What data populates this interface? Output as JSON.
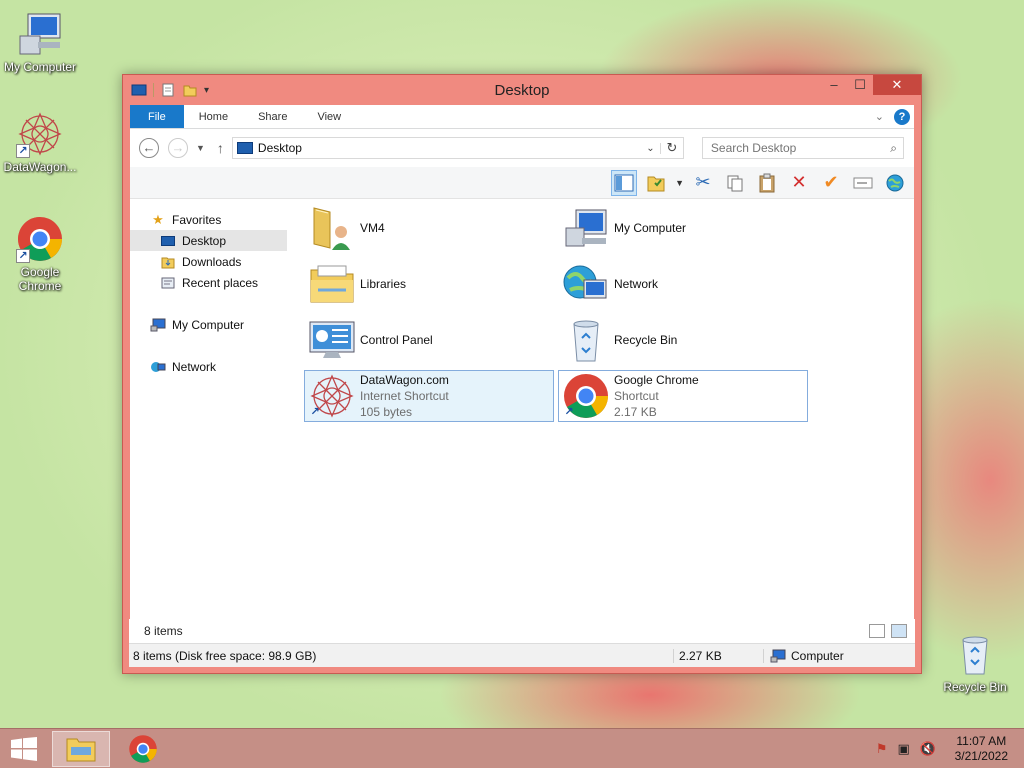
{
  "desktop": {
    "icons": [
      {
        "label": "My Computer"
      },
      {
        "label": "DataWagon..."
      },
      {
        "label": "Google Chrome"
      },
      {
        "label": "Recycle Bin"
      }
    ]
  },
  "window": {
    "title": "Desktop",
    "controls": {
      "minimize": "–",
      "maximize": "☐",
      "close": "✕"
    },
    "ribbon_tabs": [
      "File",
      "Home",
      "Share",
      "View"
    ],
    "address": "Desktop",
    "search_placeholder": "Search Desktop",
    "nav": {
      "favorites": "Favorites",
      "desktop": "Desktop",
      "downloads": "Downloads",
      "recent": "Recent places",
      "computer": "My Computer",
      "network": "Network"
    },
    "items": [
      {
        "name": "VM4",
        "sub1": "",
        "sub2": ""
      },
      {
        "name": "My Computer",
        "sub1": "",
        "sub2": ""
      },
      {
        "name": "Libraries",
        "sub1": "",
        "sub2": ""
      },
      {
        "name": "Network",
        "sub1": "",
        "sub2": ""
      },
      {
        "name": "Control Panel",
        "sub1": "",
        "sub2": ""
      },
      {
        "name": "Recycle Bin",
        "sub1": "",
        "sub2": ""
      },
      {
        "name": "DataWagon.com",
        "sub1": "Internet Shortcut",
        "sub2": "105 bytes"
      },
      {
        "name": "Google Chrome",
        "sub1": "Shortcut",
        "sub2": "2.17 KB"
      }
    ],
    "status": {
      "count": "8 items",
      "details": "8 items (Disk free space: 98.9 GB)",
      "size": "2.27 KB",
      "location": "Computer"
    }
  },
  "taskbar": {
    "time": "11:07 AM",
    "date": "3/21/2022"
  },
  "colors": {
    "title_bar": "#f08a80",
    "accent": "#1979ca",
    "taskbar": "#c58f86"
  }
}
